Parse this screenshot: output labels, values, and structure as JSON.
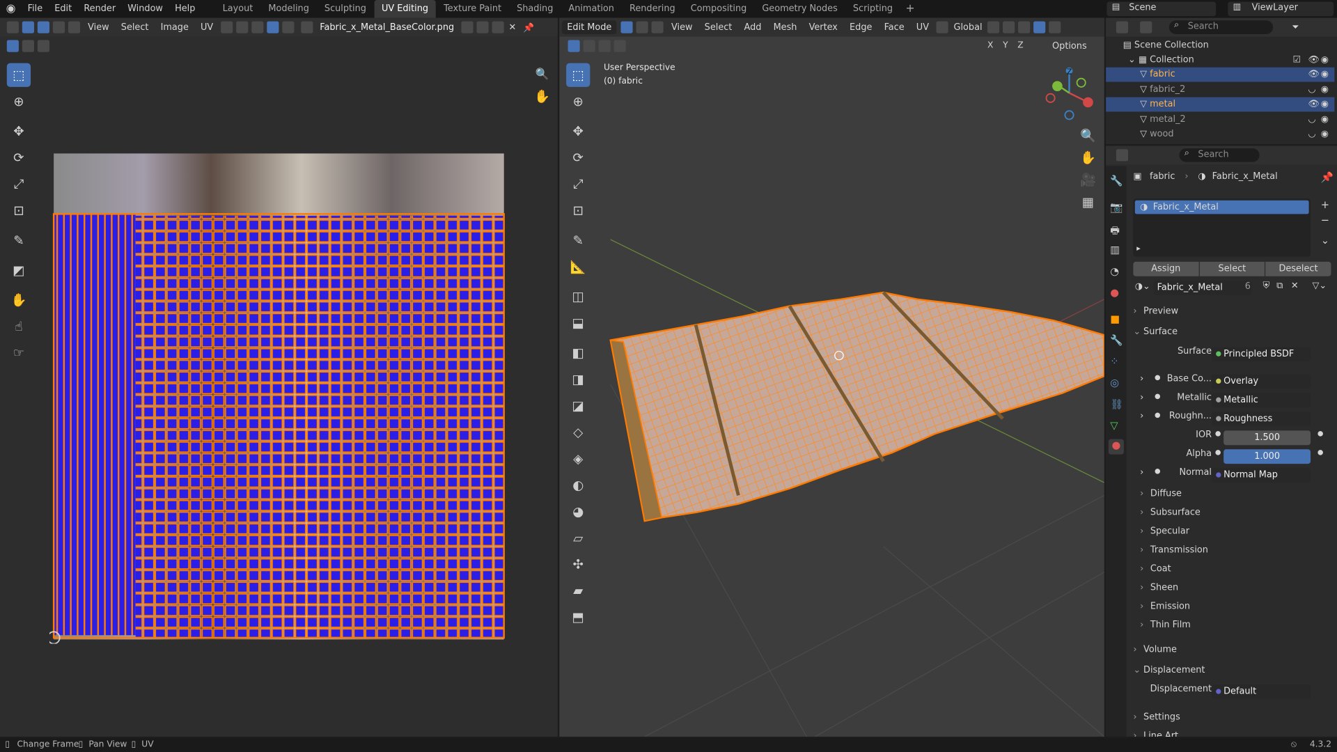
{
  "menu": [
    "File",
    "Edit",
    "Render",
    "Window",
    "Help"
  ],
  "workspaces": [
    {
      "label": "Layout",
      "active": false
    },
    {
      "label": "Modeling",
      "active": false
    },
    {
      "label": "Sculpting",
      "active": false
    },
    {
      "label": "UV Editing",
      "active": true
    },
    {
      "label": "Texture Paint",
      "active": false
    },
    {
      "label": "Shading",
      "active": false
    },
    {
      "label": "Animation",
      "active": false
    },
    {
      "label": "Rendering",
      "active": false
    },
    {
      "label": "Compositing",
      "active": false
    },
    {
      "label": "Geometry Nodes",
      "active": false
    },
    {
      "label": "Scripting",
      "active": false
    }
  ],
  "scene": {
    "name": "Scene",
    "view_layer": "ViewLayer"
  },
  "uv_editor": {
    "menus": [
      "View",
      "Select",
      "Image",
      "UV"
    ],
    "image_name": "Fabric_x_Metal_BaseColor.png"
  },
  "viewport": {
    "mode": "Edit Mode",
    "menus": [
      "View",
      "Select",
      "Add",
      "Mesh",
      "Vertex",
      "Edge",
      "Face",
      "UV"
    ],
    "orientation": "Global",
    "perspective": "User Perspective",
    "object": "(0) fabric",
    "options": "Options",
    "axes": [
      "X",
      "Y",
      "Z"
    ]
  },
  "outliner": {
    "search_placeholder": "Search",
    "scene_collection": "Scene Collection",
    "collection": "Collection",
    "objects": [
      {
        "name": "fabric",
        "selected": true
      },
      {
        "name": "fabric_2",
        "selected": false
      },
      {
        "name": "metal",
        "selected": true
      },
      {
        "name": "metal_2",
        "selected": false
      },
      {
        "name": "wood",
        "selected": false
      }
    ]
  },
  "properties": {
    "search_placeholder": "Search",
    "breadcrumb": {
      "object": "fabric",
      "material": "Fabric_x_Metal"
    },
    "slot": "Fabric_x_Metal",
    "assign": "Assign",
    "select": "Select",
    "deselect": "Deselect",
    "material_name": "Fabric_x_Metal",
    "user_count": "6",
    "preview": "Preview",
    "surface_panel": "Surface",
    "surface_label": "Surface",
    "surface_value": "Principled BSDF",
    "inputs": [
      {
        "label": "Base Co...",
        "value": "Overlay"
      },
      {
        "label": "Metallic",
        "value": "Metallic"
      },
      {
        "label": "Roughn...",
        "value": "Roughness"
      }
    ],
    "ior_label": "IOR",
    "ior": "1.500",
    "alpha_label": "Alpha",
    "alpha": "1.000",
    "normal_label": "Normal",
    "normal_value": "Normal Map",
    "subpanels": [
      "Diffuse",
      "Subsurface",
      "Specular",
      "Transmission",
      "Coat",
      "Sheen",
      "Emission",
      "Thin Film"
    ],
    "volume": "Volume",
    "displacement_panel": "Displacement",
    "displacement_label": "Displacement",
    "displacement_value": "Default",
    "settings": "Settings",
    "line_art": "Line Art"
  },
  "status": {
    "change_frame": "Change Frame",
    "pan_view": "Pan View",
    "uv": "UV",
    "version": "4.3.2"
  },
  "colors": {
    "accent": "#4772b3",
    "selection": "#ff7a00",
    "uv_fill": "#2b1ee6"
  }
}
